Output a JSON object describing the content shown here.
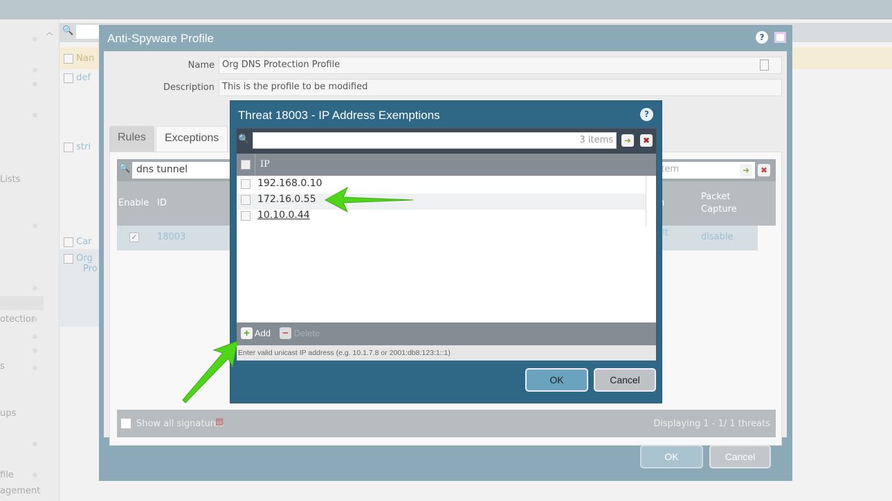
{
  "sidebar": {
    "items": [
      "Lists",
      "otection",
      "s",
      "ups",
      "file",
      "agement"
    ]
  },
  "background_table": {
    "header": "Nan",
    "rows": [
      "def",
      "stri",
      "Car",
      "Org",
      "Pro"
    ]
  },
  "outer_dialog": {
    "title": "Anti-Spyware Profile",
    "name_label": "Name",
    "name_value": "Org DNS Protection Profile",
    "description_label": "Description",
    "description_value": "This is the profile to be modified",
    "tabs": [
      "Rules",
      "Exceptions"
    ],
    "active_tab": "Exceptions",
    "search_value": "dns tunnel",
    "item_count": "1 item",
    "columns": [
      "Enable",
      "ID",
      "n",
      "Packet Capture"
    ],
    "row": {
      "id": "18003",
      "action": "ult",
      "action2": ")",
      "packet_capture": "disable"
    },
    "show_all_label": "Show all signatures",
    "displaying": "Displaying 1 - 1/ 1 threats",
    "ok": "OK",
    "cancel": "Cancel"
  },
  "modal": {
    "title": "Threat 18003 - IP Address Exemptions",
    "search_placeholder": "",
    "item_count": "3 items",
    "column": "IP",
    "ips": [
      "192.168.0.10",
      "172.16.0.55",
      "10.10.0.44"
    ],
    "add_label": "Add",
    "delete_label": "Delete",
    "hint": "Enter valid unicast IP address (e.g. 10.1.7.8 or 2001:db8:123:1::1)",
    "ok": "OK",
    "cancel": "Cancel"
  },
  "colors": {
    "modal_bg": "#2f6887",
    "outer_bg": "#8ba9b7",
    "annotation_arrow": "#4fd61a"
  }
}
